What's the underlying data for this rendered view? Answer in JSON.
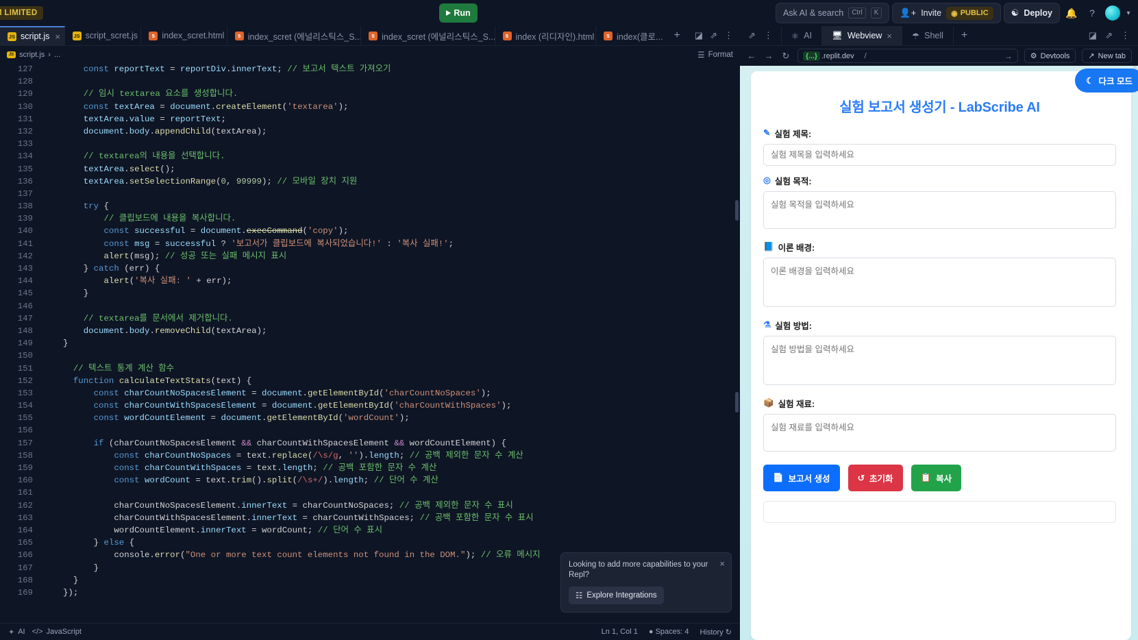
{
  "topbar": {
    "badge": "M LIMITED",
    "run_label": "Run",
    "search_placeholder": "Ask AI & search",
    "kbd_ctrl": "Ctrl",
    "kbd_k": "K",
    "invite_label": "Invite",
    "public_label": "PUBLIC",
    "deploy_label": "Deploy",
    "bell_icon": "bell-icon",
    "help_icon": "question-mark-icon",
    "avatar_icon": "user-avatar",
    "chevron_icon": "chevron-down-icon"
  },
  "editor": {
    "tabs": [
      {
        "label": "script.js",
        "type": "js",
        "active": true,
        "closable": true
      },
      {
        "label": "script_scret.js",
        "type": "js",
        "active": false,
        "closable": false
      },
      {
        "label": "index_scret.html",
        "type": "html",
        "active": false,
        "closable": false
      },
      {
        "label": "index_scret (에널리스틱스_S...",
        "type": "html",
        "active": false,
        "closable": false
      },
      {
        "label": "index_scret (에널리스틱스_S...",
        "type": "html",
        "active": false,
        "closable": false
      },
      {
        "label": "index (리디자인).html",
        "type": "html",
        "active": false,
        "closable": false
      },
      {
        "label": "index(클로...",
        "type": "html",
        "active": false,
        "closable": false
      }
    ],
    "new_tab_label": "+",
    "breadcrumb_file": "script.js",
    "breadcrumb_sep": "›",
    "breadcrumb_rest": "...",
    "format_label": "Format",
    "status": {
      "ai_label": "AI",
      "language": "JavaScript",
      "cursor": "Ln 1, Col 1",
      "spaces": "Spaces: 4",
      "history": "History"
    }
  },
  "code": {
    "first_line": 127,
    "lines": [
      [
        [
          "pl",
          "    "
        ],
        [
          "k",
          "const"
        ],
        [
          "pl",
          " "
        ],
        [
          "vr",
          "reportText"
        ],
        [
          "pl",
          " = "
        ],
        [
          "vr",
          "reportDiv"
        ],
        [
          "pl",
          "."
        ],
        [
          "vr",
          "innerText"
        ],
        [
          "pl",
          "; "
        ],
        [
          "cm",
          "// 보고서 텍스트 가져오기"
        ]
      ],
      [],
      [
        [
          "pl",
          "    "
        ],
        [
          "cm",
          "// 임시 textarea 요소를 생성합니다."
        ]
      ],
      [
        [
          "pl",
          "    "
        ],
        [
          "k",
          "const"
        ],
        [
          "pl",
          " "
        ],
        [
          "vr",
          "textArea"
        ],
        [
          "pl",
          " = "
        ],
        [
          "vr",
          "document"
        ],
        [
          "pl",
          "."
        ],
        [
          "fn",
          "createElement"
        ],
        [
          "pl",
          "("
        ],
        [
          "st",
          "'textarea'"
        ],
        [
          "pl",
          ");"
        ]
      ],
      [
        [
          "pl",
          "    "
        ],
        [
          "vr",
          "textArea"
        ],
        [
          "pl",
          "."
        ],
        [
          "vr",
          "value"
        ],
        [
          "pl",
          " = "
        ],
        [
          "vr",
          "reportText"
        ],
        [
          "pl",
          ";"
        ]
      ],
      [
        [
          "pl",
          "    "
        ],
        [
          "vr",
          "document"
        ],
        [
          "pl",
          "."
        ],
        [
          "vr",
          "body"
        ],
        [
          "pl",
          "."
        ],
        [
          "fn",
          "appendChild"
        ],
        [
          "pl",
          "(textArea);"
        ]
      ],
      [],
      [
        [
          "pl",
          "    "
        ],
        [
          "cm",
          "// textarea의 내용을 선택합니다."
        ]
      ],
      [
        [
          "pl",
          "    "
        ],
        [
          "vr",
          "textArea"
        ],
        [
          "pl",
          "."
        ],
        [
          "fn",
          "select"
        ],
        [
          "pl",
          "();"
        ]
      ],
      [
        [
          "pl",
          "    "
        ],
        [
          "vr",
          "textArea"
        ],
        [
          "pl",
          "."
        ],
        [
          "fn",
          "setSelectionRange"
        ],
        [
          "pl",
          "("
        ],
        [
          "nm",
          "0"
        ],
        [
          "pl",
          ", "
        ],
        [
          "nm",
          "99999"
        ],
        [
          "pl",
          "); "
        ],
        [
          "cm",
          "// 모바일 장치 지원"
        ]
      ],
      [],
      [
        [
          "pl",
          "    "
        ],
        [
          "k",
          "try"
        ],
        [
          "pl",
          " {"
        ]
      ],
      [
        [
          "pl",
          "        "
        ],
        [
          "cm",
          "// 클립보드에 내용을 복사합니다."
        ]
      ],
      [
        [
          "pl",
          "        "
        ],
        [
          "k",
          "const"
        ],
        [
          "pl",
          " "
        ],
        [
          "vr",
          "successful"
        ],
        [
          "pl",
          " = "
        ],
        [
          "vr",
          "document"
        ],
        [
          "pl",
          "."
        ],
        [
          "dep",
          "execCommand"
        ],
        [
          "pl",
          "("
        ],
        [
          "st",
          "'copy'"
        ],
        [
          "pl",
          ");"
        ]
      ],
      [
        [
          "pl",
          "        "
        ],
        [
          "k",
          "const"
        ],
        [
          "pl",
          " "
        ],
        [
          "vr",
          "msg"
        ],
        [
          "pl",
          " = "
        ],
        [
          "vr",
          "successful"
        ],
        [
          "pl",
          " ? "
        ],
        [
          "st",
          "'보고서가 클립보드에 복사되었습니다!'"
        ],
        [
          "pl",
          " : "
        ],
        [
          "st",
          "'복사 실패!'"
        ],
        [
          "pl",
          ";"
        ]
      ],
      [
        [
          "pl",
          "        "
        ],
        [
          "fn",
          "alert"
        ],
        [
          "pl",
          "(msg); "
        ],
        [
          "cm",
          "// 성공 또는 실패 메시지 표시"
        ]
      ],
      [
        [
          "pl",
          "    } "
        ],
        [
          "k",
          "catch"
        ],
        [
          "pl",
          " (err) {"
        ]
      ],
      [
        [
          "pl",
          "        "
        ],
        [
          "fn",
          "alert"
        ],
        [
          "pl",
          "("
        ],
        [
          "st",
          "'복사 실패: '"
        ],
        [
          "pl",
          " + err);"
        ]
      ],
      [
        [
          "pl",
          "    }"
        ]
      ],
      [],
      [
        [
          "pl",
          "    "
        ],
        [
          "cm",
          "// textarea를 문서에서 제거합니다."
        ]
      ],
      [
        [
          "pl",
          "    "
        ],
        [
          "vr",
          "document"
        ],
        [
          "pl",
          "."
        ],
        [
          "vr",
          "body"
        ],
        [
          "pl",
          "."
        ],
        [
          "fn",
          "removeChild"
        ],
        [
          "pl",
          "(textArea);"
        ]
      ],
      [
        [
          "pl",
          "}"
        ]
      ],
      [],
      [
        [
          "pl",
          "  "
        ],
        [
          "cm",
          "// 텍스트 통계 계산 함수"
        ]
      ],
      [
        [
          "pl",
          "  "
        ],
        [
          "k",
          "function"
        ],
        [
          "pl",
          " "
        ],
        [
          "fn",
          "calculateTextStats"
        ],
        [
          "pl",
          "(text) {"
        ]
      ],
      [
        [
          "pl",
          "      "
        ],
        [
          "k",
          "const"
        ],
        [
          "pl",
          " "
        ],
        [
          "vr",
          "charCountNoSpacesElement"
        ],
        [
          "pl",
          " = "
        ],
        [
          "vr",
          "document"
        ],
        [
          "pl",
          "."
        ],
        [
          "fn",
          "getElementById"
        ],
        [
          "pl",
          "("
        ],
        [
          "st",
          "'charCountNoSpaces'"
        ],
        [
          "pl",
          ");"
        ]
      ],
      [
        [
          "pl",
          "      "
        ],
        [
          "k",
          "const"
        ],
        [
          "pl",
          " "
        ],
        [
          "vr",
          "charCountWithSpacesElement"
        ],
        [
          "pl",
          " = "
        ],
        [
          "vr",
          "document"
        ],
        [
          "pl",
          "."
        ],
        [
          "fn",
          "getElementById"
        ],
        [
          "pl",
          "("
        ],
        [
          "st",
          "'charCountWithSpaces'"
        ],
        [
          "pl",
          ");"
        ]
      ],
      [
        [
          "pl",
          "      "
        ],
        [
          "k",
          "const"
        ],
        [
          "pl",
          " "
        ],
        [
          "vr",
          "wordCountElement"
        ],
        [
          "pl",
          " = "
        ],
        [
          "vr",
          "document"
        ],
        [
          "pl",
          "."
        ],
        [
          "fn",
          "getElementById"
        ],
        [
          "pl",
          "("
        ],
        [
          "st",
          "'wordCount'"
        ],
        [
          "pl",
          ");"
        ]
      ],
      [],
      [
        [
          "pl",
          "      "
        ],
        [
          "k",
          "if"
        ],
        [
          "pl",
          " (charCountNoSpacesElement "
        ],
        [
          "kw",
          "&&"
        ],
        [
          "pl",
          " charCountWithSpacesElement "
        ],
        [
          "kw",
          "&&"
        ],
        [
          "pl",
          " wordCountElement) {"
        ]
      ],
      [
        [
          "pl",
          "          "
        ],
        [
          "k",
          "const"
        ],
        [
          "pl",
          " "
        ],
        [
          "vr",
          "charCountNoSpaces"
        ],
        [
          "pl",
          " = text."
        ],
        [
          "fn",
          "replace"
        ],
        [
          "pl",
          "("
        ],
        [
          "rx",
          "/\\s/g"
        ],
        [
          "pl",
          ", "
        ],
        [
          "st",
          "''"
        ],
        [
          "pl",
          ")."
        ],
        [
          "vr",
          "length"
        ],
        [
          "pl",
          "; "
        ],
        [
          "cm",
          "// 공백 제외한 문자 수 계산"
        ]
      ],
      [
        [
          "pl",
          "          "
        ],
        [
          "k",
          "const"
        ],
        [
          "pl",
          " "
        ],
        [
          "vr",
          "charCountWithSpaces"
        ],
        [
          "pl",
          " = text."
        ],
        [
          "vr",
          "length"
        ],
        [
          "pl",
          "; "
        ],
        [
          "cm",
          "// 공백 포함한 문자 수 계산"
        ]
      ],
      [
        [
          "pl",
          "          "
        ],
        [
          "k",
          "const"
        ],
        [
          "pl",
          " "
        ],
        [
          "vr",
          "wordCount"
        ],
        [
          "pl",
          " = text."
        ],
        [
          "fn",
          "trim"
        ],
        [
          "pl",
          "()."
        ],
        [
          "fn",
          "split"
        ],
        [
          "pl",
          "("
        ],
        [
          "rx",
          "/\\s+/"
        ],
        [
          "pl",
          ")."
        ],
        [
          "vr",
          "length"
        ],
        [
          "pl",
          "; "
        ],
        [
          "cm",
          "// 단어 수 계산"
        ]
      ],
      [],
      [
        [
          "pl",
          "          charCountNoSpacesElement."
        ],
        [
          "vr",
          "innerText"
        ],
        [
          "pl",
          " = charCountNoSpaces; "
        ],
        [
          "cm",
          "// 공백 제외한 문자 수 표시"
        ]
      ],
      [
        [
          "pl",
          "          charCountWithSpacesElement."
        ],
        [
          "vr",
          "innerText"
        ],
        [
          "pl",
          " = charCountWithSpaces; "
        ],
        [
          "cm",
          "// 공백 포함한 문자 수 표시"
        ]
      ],
      [
        [
          "pl",
          "          wordCountElement."
        ],
        [
          "vr",
          "innerText"
        ],
        [
          "pl",
          " = wordCount; "
        ],
        [
          "cm",
          "// 단어 수 표시"
        ]
      ],
      [
        [
          "pl",
          "      } "
        ],
        [
          "k",
          "else"
        ],
        [
          "pl",
          " {"
        ]
      ],
      [
        [
          "pl",
          "          console."
        ],
        [
          "fn",
          "error"
        ],
        [
          "pl",
          "("
        ],
        [
          "st",
          "\"One or more text count elements not found in the DOM.\""
        ],
        [
          "pl",
          "); "
        ],
        [
          "cm",
          "// 오류 메시지"
        ]
      ],
      [
        [
          "pl",
          "      }"
        ]
      ],
      [
        [
          "pl",
          "  }"
        ]
      ],
      [
        [
          "pl",
          "});"
        ]
      ]
    ]
  },
  "toast": {
    "message": "Looking to add more capabilities to your Repl?",
    "button_label": "Explore Integrations",
    "close_icon": "close-icon"
  },
  "rightpane": {
    "tabs": [
      {
        "label": "AI",
        "icon": "ai-icon",
        "active": false
      },
      {
        "label": "Webview",
        "icon": "monitor-icon",
        "active": true
      },
      {
        "label": "Shell",
        "icon": "shell-icon",
        "active": false
      }
    ],
    "new_tab_label": "+",
    "url_chip": "{...}",
    "url_host": ".replit.dev",
    "url_path": "/",
    "devtools_label": "Devtools",
    "newtab_label": "New tab"
  },
  "app": {
    "title": "실험 보고서 생성기 - LabScribe AI",
    "dark_mode_label": "다크 모드",
    "dark_mode_icon": "moon-icon",
    "fields": [
      {
        "icon": "✏️",
        "icon_name": "pencil-icon",
        "label": "실험 제목:",
        "placeholder": "실험 제목을 입력하세요",
        "kind": "input"
      },
      {
        "icon": "◎",
        "icon_name": "target-icon",
        "label": "실험 목적:",
        "placeholder": "실험 목적을 입력하세요",
        "kind": "textarea"
      },
      {
        "icon": "📘",
        "icon_name": "book-icon",
        "label": "이론 배경:",
        "placeholder": "이론 배경을 입력하세요",
        "kind": "textarea-tall"
      },
      {
        "icon": "🧪",
        "icon_name": "flask-icon",
        "label": "실험 방법:",
        "placeholder": "실험 방법을 입력하세요",
        "kind": "textarea-tall"
      },
      {
        "icon": "🧰",
        "icon_name": "toolbox-icon",
        "label": "실험 재료:",
        "placeholder": "실험 재료를 입력하세요",
        "kind": "textarea"
      }
    ],
    "buttons": [
      {
        "icon": "📄",
        "icon_name": "document-icon",
        "label": "보고서 생성",
        "color": "#0d6efd",
        "style": "blue"
      },
      {
        "icon": "↺",
        "icon_name": "reset-icon",
        "label": "초기화",
        "color": "#dc3545",
        "style": "red"
      },
      {
        "icon": "📋",
        "icon_name": "copy-icon",
        "label": "복사",
        "color": "#22a34a",
        "style": "green"
      }
    ]
  }
}
